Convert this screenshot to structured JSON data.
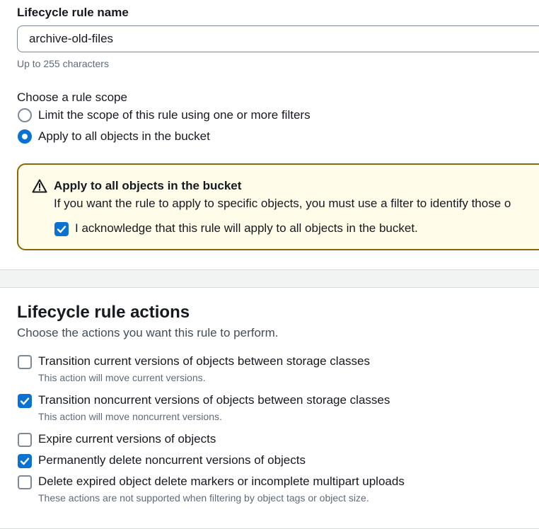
{
  "rule_name": {
    "label": "Lifecycle rule name",
    "value": "archive-old-files",
    "hint": "Up to 255 characters"
  },
  "scope": {
    "label": "Choose a rule scope",
    "options": [
      {
        "label": "Limit the scope of this rule using one or more filters",
        "selected": false
      },
      {
        "label": "Apply to all objects in the bucket",
        "selected": true
      }
    ]
  },
  "warning": {
    "icon": "warning-icon",
    "title": "Apply to all objects in the bucket",
    "message": "If you want the rule to apply to specific objects, you must use a filter to identify those o",
    "ack_label": "I acknowledge that this rule will apply to all objects in the bucket.",
    "ack_checked": true,
    "colors": {
      "background": "#fffce9",
      "border": "#8d6605"
    }
  },
  "actions": {
    "title": "Lifecycle rule actions",
    "description": "Choose the actions you want this rule to perform.",
    "items": [
      {
        "label": "Transition current versions of objects between storage classes",
        "checked": false,
        "sub": "This action will move current versions."
      },
      {
        "label": "Transition noncurrent versions of objects between storage classes",
        "checked": true,
        "sub": "This action will move noncurrent versions."
      },
      {
        "label": "Expire current versions of objects",
        "checked": false
      },
      {
        "label": "Permanently delete noncurrent versions of objects",
        "checked": true
      },
      {
        "label": "Delete expired object delete markers or incomplete multipart uploads",
        "checked": false,
        "sub": "These actions are not supported when filtering by object tags or object size."
      }
    ]
  },
  "colors": {
    "accent": "#0972d3",
    "text": "#16191f",
    "muted": "#5f6b7a"
  }
}
